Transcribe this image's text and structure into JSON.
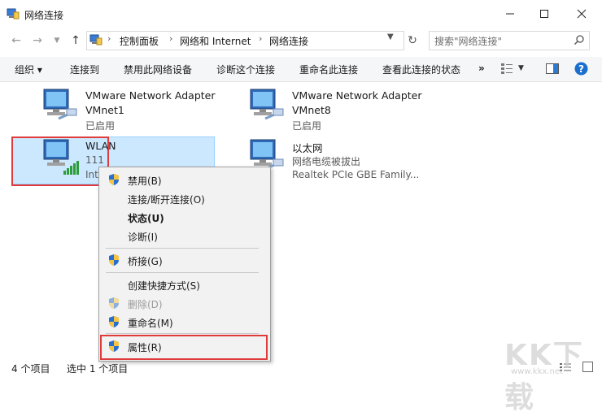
{
  "window": {
    "title": "网络连接"
  },
  "address": {
    "crumbs": [
      "控制面板",
      "网络和 Internet",
      "网络连接"
    ]
  },
  "search": {
    "placeholder": "搜索\"网络连接\""
  },
  "toolbar": {
    "organize": "组织 ▾",
    "commands": [
      "连接到",
      "禁用此网络设备",
      "诊断这个连接",
      "重命名此连接",
      "查看此连接的状态"
    ],
    "more": "»"
  },
  "connections": [
    {
      "name": "VMware Network Adapter",
      "line2": "VMnet1",
      "line3": "已启用"
    },
    {
      "name": "VMware Network Adapter",
      "line2": "VMnet8",
      "line3": "已启用"
    },
    {
      "name": "WLAN",
      "line2": "111",
      "line3": "Inte"
    },
    {
      "name": "以太网",
      "line2": "网络电缆被拔出",
      "line3": "Realtek PCIe GBE Family..."
    }
  ],
  "context_menu": {
    "items": [
      {
        "label": "禁用(B)"
      },
      {
        "label": "连接/断开连接(O)"
      },
      {
        "label": "状态(U)"
      },
      {
        "label": "诊断(I)"
      },
      {
        "label": "桥接(G)"
      },
      {
        "label": "创建快捷方式(S)"
      },
      {
        "label": "删除(D)"
      },
      {
        "label": "重命名(M)"
      },
      {
        "label": "属性(R)"
      }
    ]
  },
  "statusbar": {
    "count": "4 个项目",
    "selected": "选中 1 个项目"
  },
  "watermark": {
    "text": "KK下载",
    "url": "www.kkx.net"
  },
  "colors": {
    "selection": "#cce8ff",
    "highlight_box": "#e03b3b",
    "help": "#1a6fce"
  }
}
